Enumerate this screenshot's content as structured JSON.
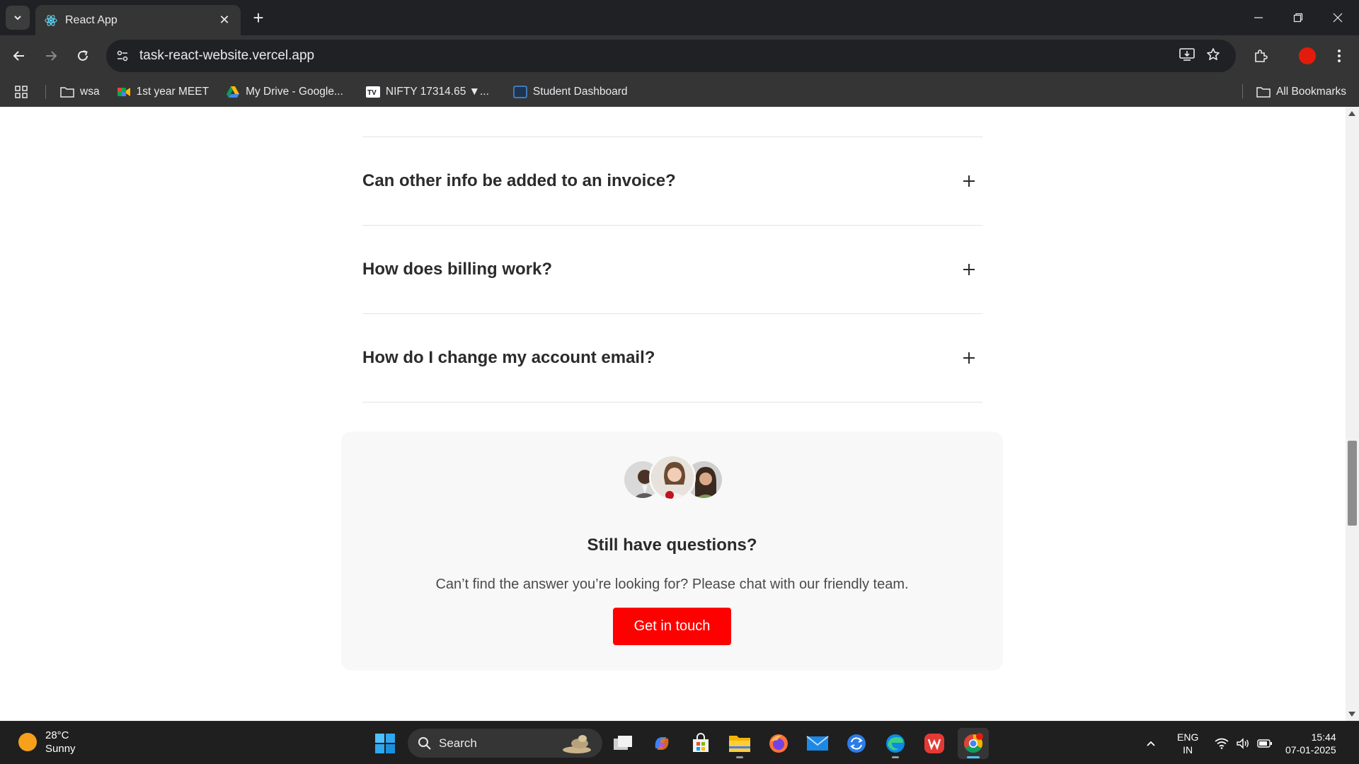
{
  "browser": {
    "tab_title": "React App",
    "url": "task-react-website.vercel.app",
    "bookmarks": [
      {
        "label": "wsa",
        "icon": "folder-icon"
      },
      {
        "label": "1st year MEET",
        "icon": "meet-icon"
      },
      {
        "label": "My Drive - Google...",
        "icon": "drive-icon"
      },
      {
        "label": "NIFTY 17314.65 ▼...",
        "icon": "tradingview-icon"
      },
      {
        "label": "Student Dashboard",
        "icon": "dashboard-icon"
      }
    ],
    "all_bookmarks": "All Bookmarks"
  },
  "faq": {
    "items": [
      {
        "question": "Can other info be added to an invoice?"
      },
      {
        "question": "How does billing work?"
      },
      {
        "question": "How do I change my account email?"
      }
    ]
  },
  "cta": {
    "title": "Still have questions?",
    "subtitle": "Can’t find the answer you’re looking for? Please chat with our friendly team.",
    "button": "Get in touch"
  },
  "taskbar": {
    "weather_temp": "28°C",
    "weather_desc": "Sunny",
    "search_label": "Search",
    "lang_top": "ENG",
    "lang_bottom": "IN",
    "time": "15:44",
    "date": "07-01-2025"
  },
  "colors": {
    "accent": "#ff0000",
    "page_bg": "#ffffff",
    "card_bg": "#f8f8f8",
    "chrome_bg": "#202124",
    "toolbar_bg": "#353535"
  }
}
